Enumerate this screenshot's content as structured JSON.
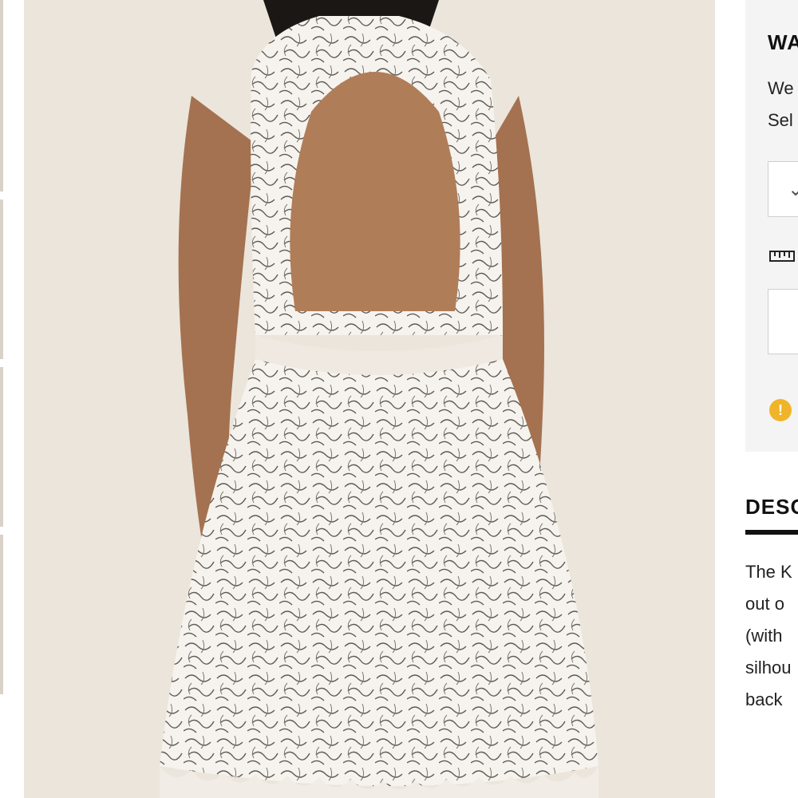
{
  "sidebar": {
    "thumbnails": [
      "thumb-1",
      "thumb-2",
      "thumb-3",
      "thumb-4"
    ]
  },
  "product_image": {
    "alt": "Back view of a white lace sleeveless skater dress with an open cutout back"
  },
  "panel": {
    "title": "WA",
    "lines": [
      "We",
      "Sel"
    ],
    "size_select_icon": "chevron-down-icon",
    "size_guide_icon": "ruler-icon",
    "alert_icon": "exclamation-icon",
    "alert_symbol": "!",
    "alert_text": ""
  },
  "description": {
    "heading": "DESC",
    "lines": [
      "The K",
      "out o",
      "(with",
      "silhou",
      "back"
    ]
  },
  "colors": {
    "photo_background": "#ebe5dc",
    "panel_card": "#f4f4f4",
    "alert": "#f0b429",
    "text": "#111111"
  }
}
